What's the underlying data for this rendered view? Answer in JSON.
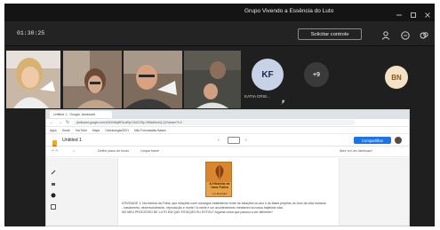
{
  "window": {
    "title": "Grupo Vivendo a Essência do Luto"
  },
  "controls": {
    "timer": "01:30:25",
    "request_control_label": "Solicitar controle"
  },
  "participants": {
    "tiles": [
      {
        "type": "video",
        "name": ""
      },
      {
        "type": "video",
        "name": ""
      },
      {
        "type": "video",
        "name": ""
      },
      {
        "type": "video",
        "name": ""
      }
    ],
    "kf": {
      "initials": "KF",
      "name": "KATIA CRIS..."
    },
    "overflow": {
      "label": "+9"
    },
    "bn": {
      "initials": "BN"
    }
  },
  "browser": {
    "tab_title": "Untitled 1 - Google Jamboard",
    "address": "jamboard.google.com/d/1I0h5kyBRLudKpCGdCG9p-ViNfwMm4Q-Q2/viewer?f=0",
    "bookmarks": [
      "Apps",
      "Gmail",
      "YouTube",
      "Maps",
      "Odontologia/2021",
      "Não Formatadas Bases"
    ]
  },
  "document": {
    "name": "Untitled 1",
    "share_label": "Compartilhar",
    "toolbar": {
      "set_background": "Definir plano de fundo",
      "clear_frame": "Limpar frame",
      "add_to_jamboard": "Abrir em um Jamboard"
    },
    "book_title": "A História de Uma Folha",
    "book_author": "Leo Buscaglia",
    "text_lines": [
      "ATIVIDADE 1: Na história da Folha, que relações você consegue estabelecer entre as estações do ano e as fases próprias do ciclo da vida humana",
      "- nascimento, desenvolvimento, reprodução e morte? A morte é um acontecimento inevitável na nossa trajetória vital.",
      "NO MEU PROCESSO DE LUTO EM QUE ESTAÇÃO EU ESTOU? Alguma coisa que passou a ver diferente?"
    ]
  },
  "colors": {
    "meeting_bg": "#1f1f1f",
    "accent_blue": "#1a73e8",
    "book_orange": "#e7a24a"
  },
  "icons": [
    "people-icon",
    "chat-icon",
    "reactions-icon",
    "jamboard-logo-icon",
    "pen-icon",
    "eraser-icon",
    "select-icon",
    "sticky-note-icon"
  ]
}
